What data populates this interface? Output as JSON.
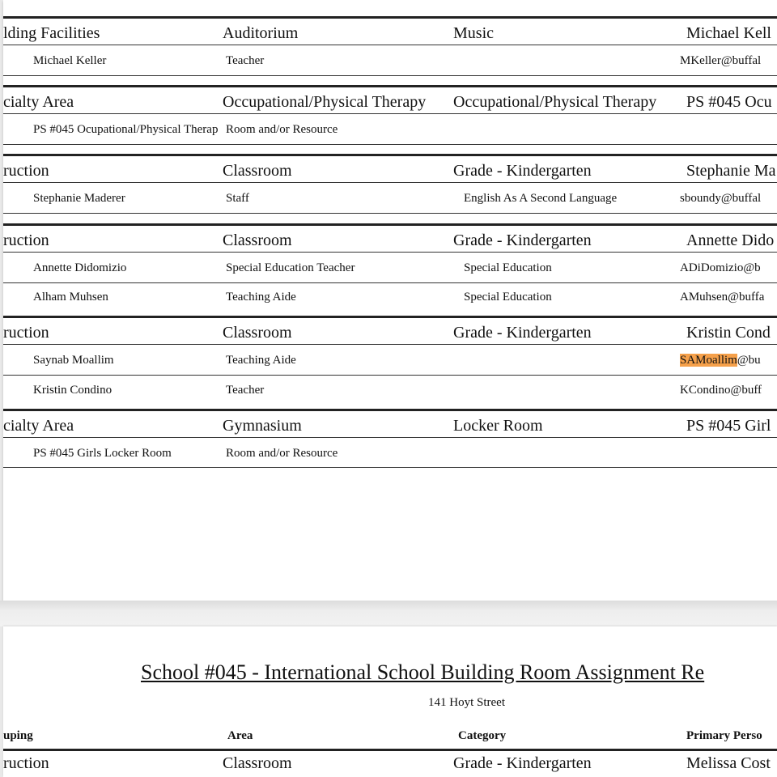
{
  "page1": {
    "groups": [
      {
        "header": [
          "lding Facilities",
          "Auditorium",
          "Music",
          "Michael Kell"
        ],
        "rows": [
          [
            "Michael Keller",
            "Teacher",
            "",
            "MKeller@buffal"
          ]
        ]
      },
      {
        "header": [
          "cialty Area",
          "Occupational/Physical Therapy",
          "Occupational/Physical Therapy",
          "PS #045 Ocu"
        ],
        "rows": [
          [
            "PS #045 Ocupational/Physical Therap",
            "Room and/or Resource",
            "",
            ""
          ]
        ]
      },
      {
        "header": [
          "ruction",
          "Classroom",
          "Grade - Kindergarten",
          "Stephanie Ma"
        ],
        "rows": [
          [
            "Stephanie Maderer",
            "Staff",
            "English As A Second Language",
            "sboundy@buffal"
          ]
        ]
      },
      {
        "header": [
          "ruction",
          "Classroom",
          "Grade - Kindergarten",
          "Annette Dido"
        ],
        "rows": [
          [
            "Annette Didomizio",
            "Special Education Teacher",
            "Special Education",
            "ADiDomizio@b"
          ],
          [
            "Alham Muhsen",
            "Teaching Aide",
            "Special Education",
            "AMuhsen@buffa"
          ]
        ]
      },
      {
        "header": [
          "ruction",
          "Classroom",
          "Grade - Kindergarten",
          "Kristin Cond"
        ],
        "rows": [
          [
            "Saynab Moallim",
            "Teaching Aide",
            "",
            "SAMoallim@bu"
          ],
          [
            "Kristin Condino",
            "Teacher",
            "",
            "KCondino@buff"
          ]
        ]
      },
      {
        "header": [
          "cialty Area",
          "Gymnasium",
          "Locker Room",
          "PS #045 Girl"
        ],
        "rows": [
          [
            "PS #045 Girls Locker Room",
            "Room and/or Resource",
            "",
            ""
          ]
        ]
      }
    ],
    "search_highlight": "SAMoallim",
    "highlight_rest": "@bu"
  },
  "page2": {
    "title": "School #045 - International School Building Room Assignment Re",
    "address": "141 Hoyt Street",
    "columns": [
      "uping",
      "Area",
      "Category",
      "Primary Perso"
    ],
    "first_row": [
      "ruction",
      "Classroom",
      "Grade - Kindergarten",
      "Melissa Cost"
    ]
  },
  "colors": {
    "highlight": "#f5a04a",
    "background": "#e9e9e9",
    "page": "#ffffff"
  }
}
